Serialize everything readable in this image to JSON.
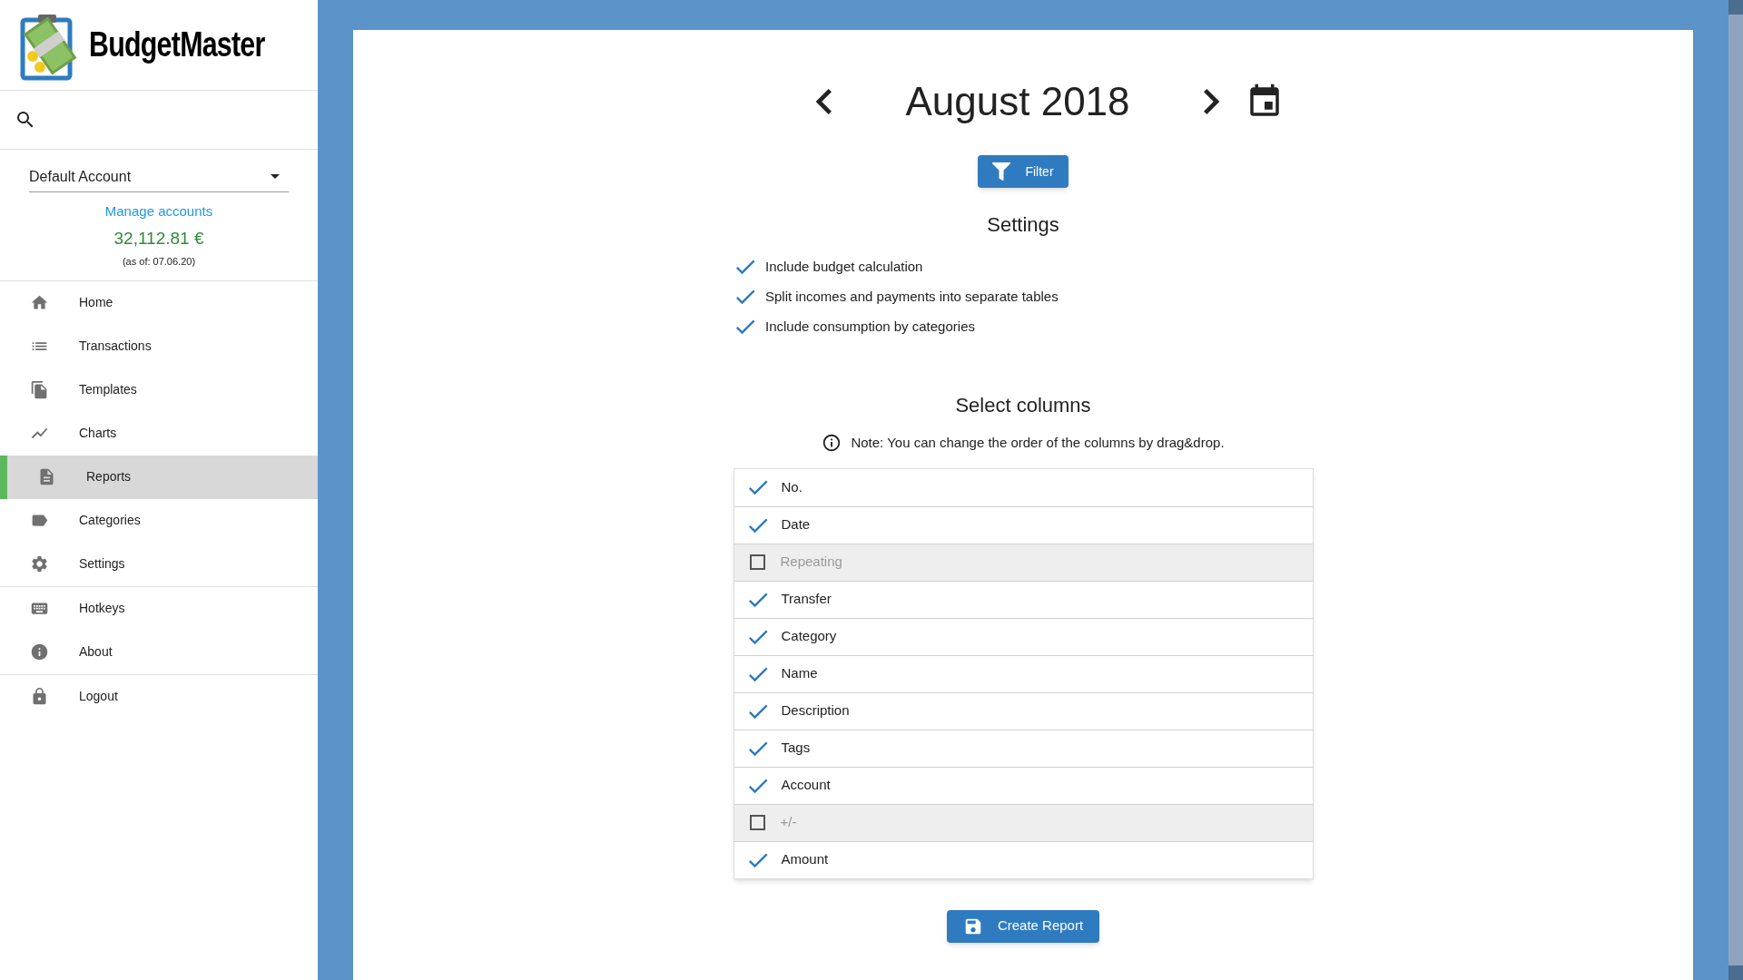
{
  "app": {
    "name": "BudgetMaster"
  },
  "sidebar": {
    "account": {
      "value": "Default Account"
    },
    "manage_link": "Manage accounts",
    "balance": "32,112.81 €",
    "balance_date": "(as of: 07.06.20)",
    "nav_sections": [
      {
        "items": [
          {
            "label": "Home",
            "selected": false
          },
          {
            "label": "Transactions",
            "selected": false
          },
          {
            "label": "Templates",
            "selected": false
          },
          {
            "label": "Charts",
            "selected": false
          },
          {
            "label": "Reports",
            "selected": true
          },
          {
            "label": "Categories",
            "selected": false
          },
          {
            "label": "Settings",
            "selected": false
          }
        ]
      },
      {
        "items": [
          {
            "label": "Hotkeys",
            "selected": false
          },
          {
            "label": "About",
            "selected": false
          }
        ]
      },
      {
        "items": [
          {
            "label": "Logout",
            "selected": false
          }
        ]
      }
    ]
  },
  "main": {
    "month": "August 2018",
    "filter_button": "Filter",
    "settings_title": "Settings",
    "settings": [
      {
        "label": "Include budget calculation",
        "checked": true
      },
      {
        "label": "Split incomes and payments into separate tables",
        "checked": true
      },
      {
        "label": "Include consumption by categories",
        "checked": true
      }
    ],
    "columns_title": "Select columns",
    "note": "Note: You can change the order of the columns by drag&drop.",
    "columns": [
      {
        "label": "No.",
        "checked": true
      },
      {
        "label": "Date",
        "checked": true
      },
      {
        "label": "Repeating",
        "checked": false
      },
      {
        "label": "Transfer",
        "checked": true
      },
      {
        "label": "Category",
        "checked": true
      },
      {
        "label": "Name",
        "checked": true
      },
      {
        "label": "Description",
        "checked": true
      },
      {
        "label": "Tags",
        "checked": true
      },
      {
        "label": "Account",
        "checked": true
      },
      {
        "label": "+/-",
        "checked": false
      },
      {
        "label": "Amount",
        "checked": true
      }
    ],
    "create_button": "Create Report"
  }
}
